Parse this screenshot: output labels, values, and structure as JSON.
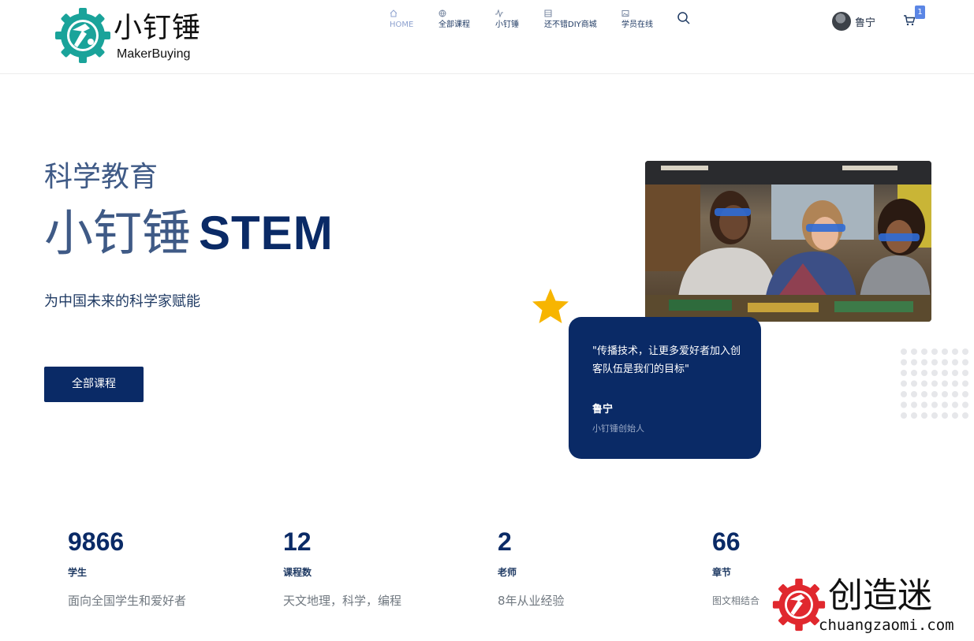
{
  "header": {
    "logo": {
      "cn": "小钉锤",
      "en": "MakerBuying"
    },
    "nav": [
      {
        "label": "HOME",
        "icon": "home-icon",
        "active": true
      },
      {
        "label": "全部课程",
        "icon": "globe-icon",
        "active": false
      },
      {
        "label": "小钉锤",
        "icon": "pulse-icon",
        "active": false
      },
      {
        "label": "还不错DIY商城",
        "icon": "list-icon",
        "active": false
      },
      {
        "label": "学员在线",
        "icon": "image-icon",
        "active": false
      }
    ],
    "search_icon": "search-icon",
    "user": {
      "name": "鲁宁"
    },
    "cart": {
      "count": "1",
      "icon": "cart-icon"
    }
  },
  "hero": {
    "subtitle": "科学教育",
    "title_cn": "小钉锤",
    "title_en": "STEM",
    "tagline": "为中国未来的科学家赋能",
    "button": "全部课程"
  },
  "quote": {
    "text": "\"传播技术，让更多爱好者加入创客队伍是我们的目标\"",
    "name": "鲁宁",
    "role": "小钉锤创始人"
  },
  "stats": [
    {
      "number": "9866",
      "label": "学生",
      "desc": "面向全国学生和爱好者"
    },
    {
      "number": "12",
      "label": "课程数",
      "desc": "天文地理，科学，编程"
    },
    {
      "number": "2",
      "label": "老师",
      "desc": "8年从业经验"
    },
    {
      "number": "66",
      "label": "章节",
      "desc": "图文相结合"
    }
  ],
  "watermark": {
    "cn": "创造迷",
    "en": "chuangzaomi.com"
  },
  "colors": {
    "primary": "#0a2a66",
    "accent": "#3f5a86",
    "star": "#f7b500",
    "logo_teal": "#1aa39a",
    "watermark_red": "#e0282e"
  }
}
